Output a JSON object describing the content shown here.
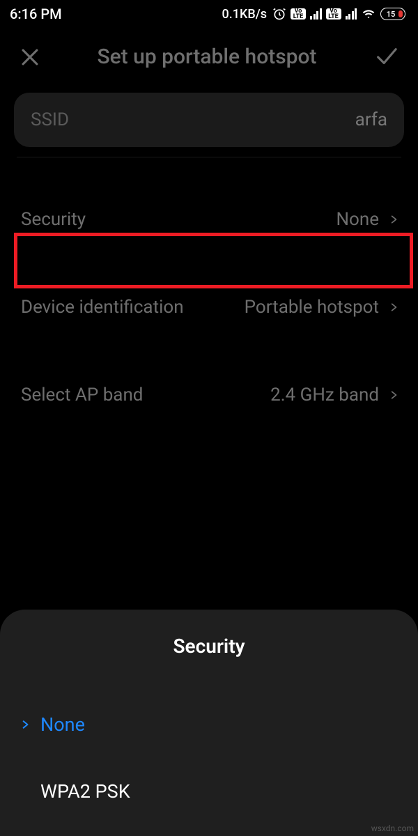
{
  "status": {
    "time": "6:16 PM",
    "data_rate": "0.1KB/s",
    "battery": "15"
  },
  "header": {
    "title": "Set up portable hotspot"
  },
  "ssid": {
    "label": "SSID",
    "value": "arfa"
  },
  "rows": {
    "security": {
      "label": "Security",
      "value": "None"
    },
    "device_id": {
      "label": "Device identification",
      "value": "Portable hotspot"
    },
    "ap_band": {
      "label": "Select AP band",
      "value": "2.4 GHz band"
    }
  },
  "sheet": {
    "title": "Security",
    "options": {
      "none": "None",
      "wpa2": "WPA2 PSK"
    }
  },
  "watermark": "wsxdn.com"
}
